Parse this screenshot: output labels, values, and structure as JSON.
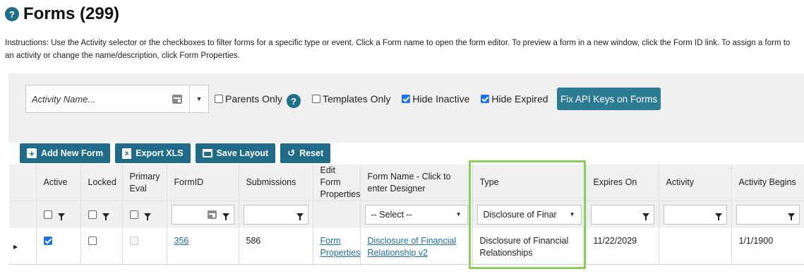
{
  "page": {
    "title": "Forms (299)",
    "instructions": "Instructions: Use the Activity selector or the checkboxes to filter forms for a specific type or event. Click a Form name to open the form editor. To preview a form in a new window, click the Form ID link. To assign a form to an activity or change the name/description, click Form Properties."
  },
  "filters": {
    "activity_placeholder": "Activity Name...",
    "parents_only": "Parents Only",
    "parents_only_checked": false,
    "templates_only": "Templates Only",
    "templates_only_checked": false,
    "hide_inactive": "Hide Inactive",
    "hide_inactive_checked": true,
    "hide_expired": "Hide Expired",
    "hide_expired_checked": true,
    "fix_api_keys_label": "Fix API Keys on Forms"
  },
  "toolbar": {
    "add_new_form": "Add New Form",
    "export_xls": "Export XLS",
    "save_layout": "Save Layout",
    "reset": "Reset"
  },
  "grid": {
    "columns": [
      "Active",
      "Locked",
      "Primary Eval",
      "FormID",
      "Submissions",
      "Edit Form Properties",
      "Form Name - Click to enter Designer",
      "Type",
      "Expires On",
      "Activity",
      "Activity Begins"
    ],
    "filters": {
      "form_name_select": "-- Select --",
      "type_select": "Disclosure of Finar"
    },
    "rows": [
      {
        "active": true,
        "locked": false,
        "primary_eval": false,
        "form_id": "356",
        "submissions": "586",
        "edit_properties": "Form Properties",
        "form_name": "Disclosure of Financial Relationship v2",
        "type": "Disclosure of Financial Relationships",
        "expires_on": "11/22/2029",
        "activity": "",
        "activity_begins": "1/1/1900"
      }
    ]
  },
  "colors": {
    "accent": "#1f6b88",
    "highlight": "#8fcd5c",
    "link": "#1f6fa8"
  }
}
